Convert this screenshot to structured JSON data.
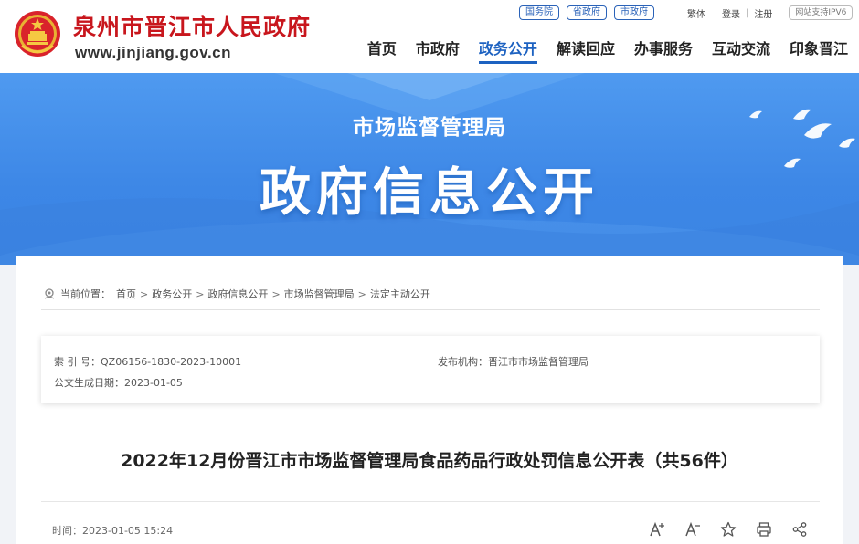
{
  "header": {
    "site_title": "泉州市晋江市人民政府",
    "site_url": "www.jinjiang.gov.cn",
    "top_pills": [
      "国务院",
      "省政府",
      "市政府"
    ],
    "util_links": [
      "繁体",
      "登录",
      "注册"
    ],
    "ipv6_badge": "网站支持IPV6",
    "nav": [
      "首页",
      "市政府",
      "政务公开",
      "解读回应",
      "办事服务",
      "互动交流",
      "印象晋江"
    ],
    "active_nav": "政务公开"
  },
  "banner": {
    "subtitle": "市场监督管理局",
    "title": "政府信息公开"
  },
  "breadcrumb": {
    "label": "当前位置：",
    "items": [
      "首页",
      "政务公开",
      "政府信息公开",
      "市场监督管理局",
      "法定主动公开"
    ],
    "separator": ">"
  },
  "meta": {
    "index_label": "索 引 号：",
    "index_value": "QZ06156-1830-2023-10001",
    "publisher_label": "发布机构：",
    "publisher_value": "晋江市市场监督管理局",
    "date_label": "公文生成日期：",
    "date_value": "2023-01-05"
  },
  "document": {
    "title": "2022年12月份晋江市市场监督管理局食品药品行政处罚信息公开表（共56件）",
    "time_label": "时间：",
    "time_value": "2023-01-05 15:24"
  },
  "colors": {
    "brand_red": "#c8161d",
    "nav_active": "#1d62c1",
    "banner_blue": "#4190ea"
  }
}
